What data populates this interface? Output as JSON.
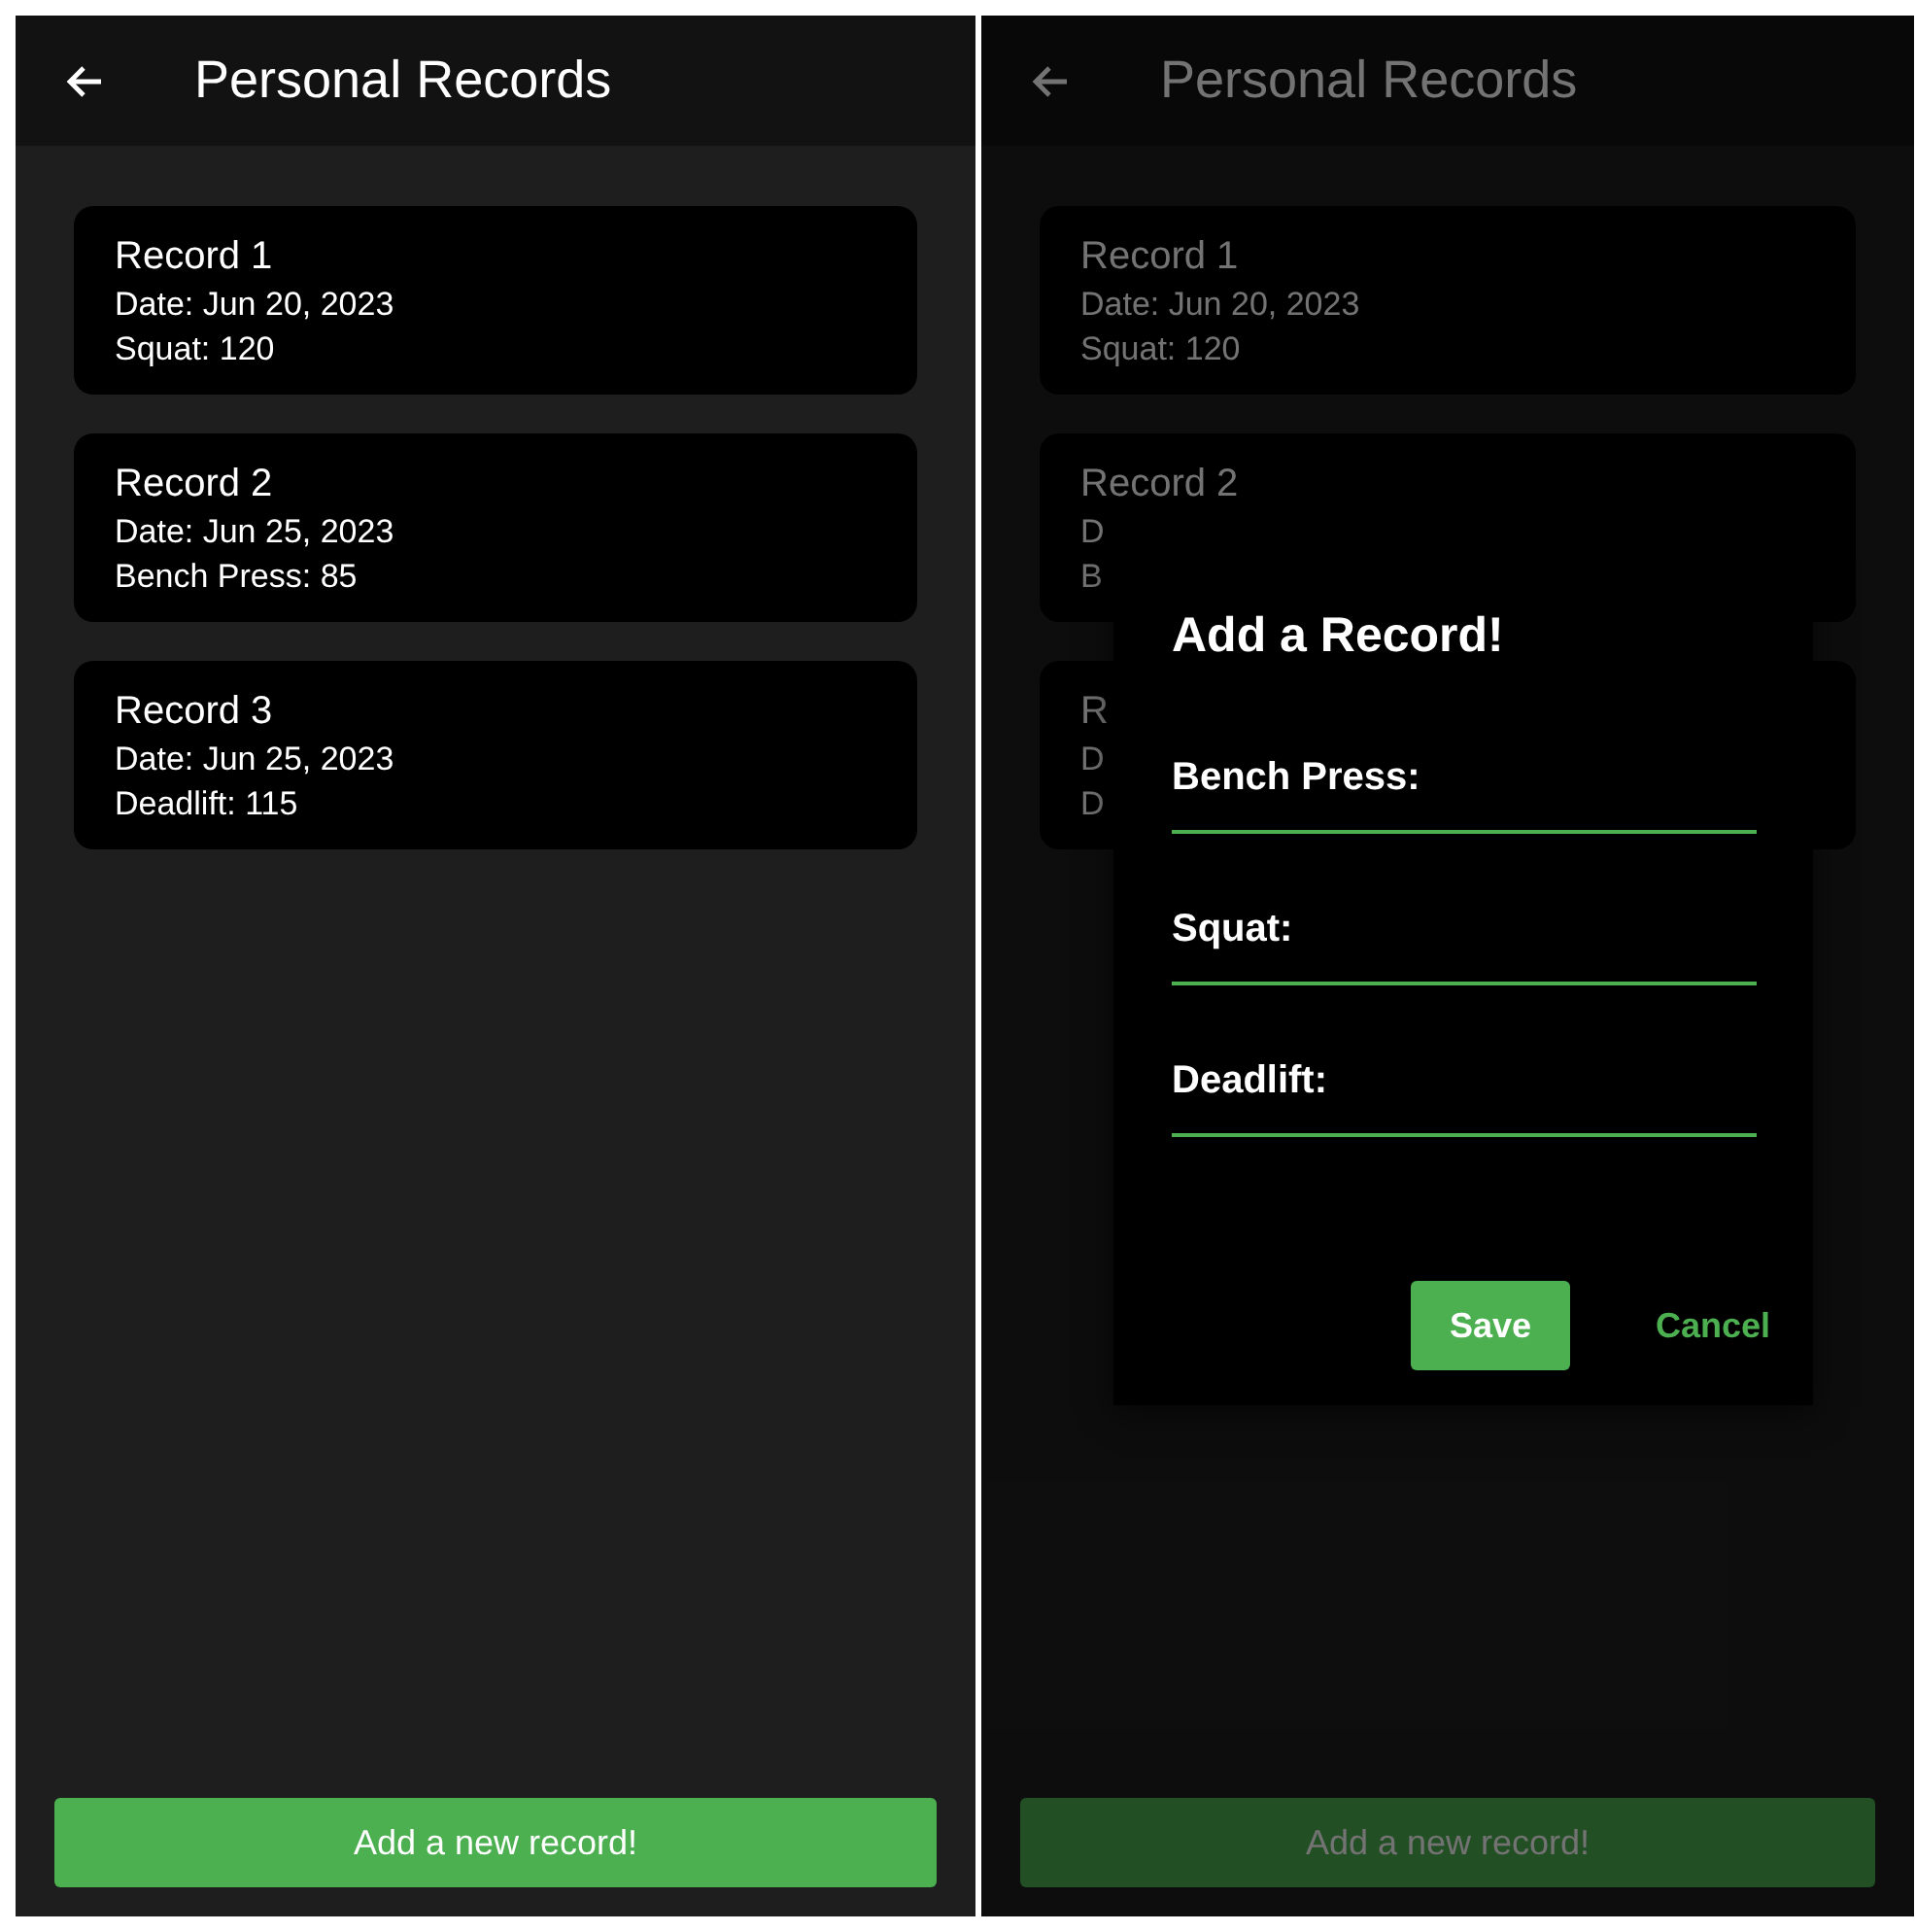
{
  "screens": [
    {
      "title": "Personal Records",
      "dimmed": false,
      "records": [
        {
          "title": "Record 1",
          "lines": [
            "Date: Jun 20, 2023",
            "Squat: 120"
          ]
        },
        {
          "title": "Record 2",
          "lines": [
            "Date: Jun 25, 2023",
            "Bench Press: 85"
          ]
        },
        {
          "title": "Record 3",
          "lines": [
            "Date: Jun 25, 2023",
            "Deadlift: 115"
          ]
        }
      ],
      "add_button": "Add a new record!"
    },
    {
      "title": "Personal Records",
      "dimmed": true,
      "records": [
        {
          "title": "Record 1",
          "lines": [
            "Date: Jun 20, 2023",
            "Squat: 120"
          ]
        },
        {
          "title": "Record 2",
          "lines": [
            "D",
            "B"
          ]
        },
        {
          "title": "R",
          "lines": [
            "D",
            "D"
          ]
        }
      ],
      "add_button": "Add a new record!",
      "dialog": {
        "title": "Add a Record!",
        "fields": [
          {
            "label": "Bench Press:"
          },
          {
            "label": "Squat:"
          },
          {
            "label": "Deadlift:"
          }
        ],
        "buttons": [
          {
            "label": "Save",
            "kind": "filled"
          },
          {
            "label": "Cancel",
            "kind": "text"
          }
        ]
      }
    }
  ]
}
